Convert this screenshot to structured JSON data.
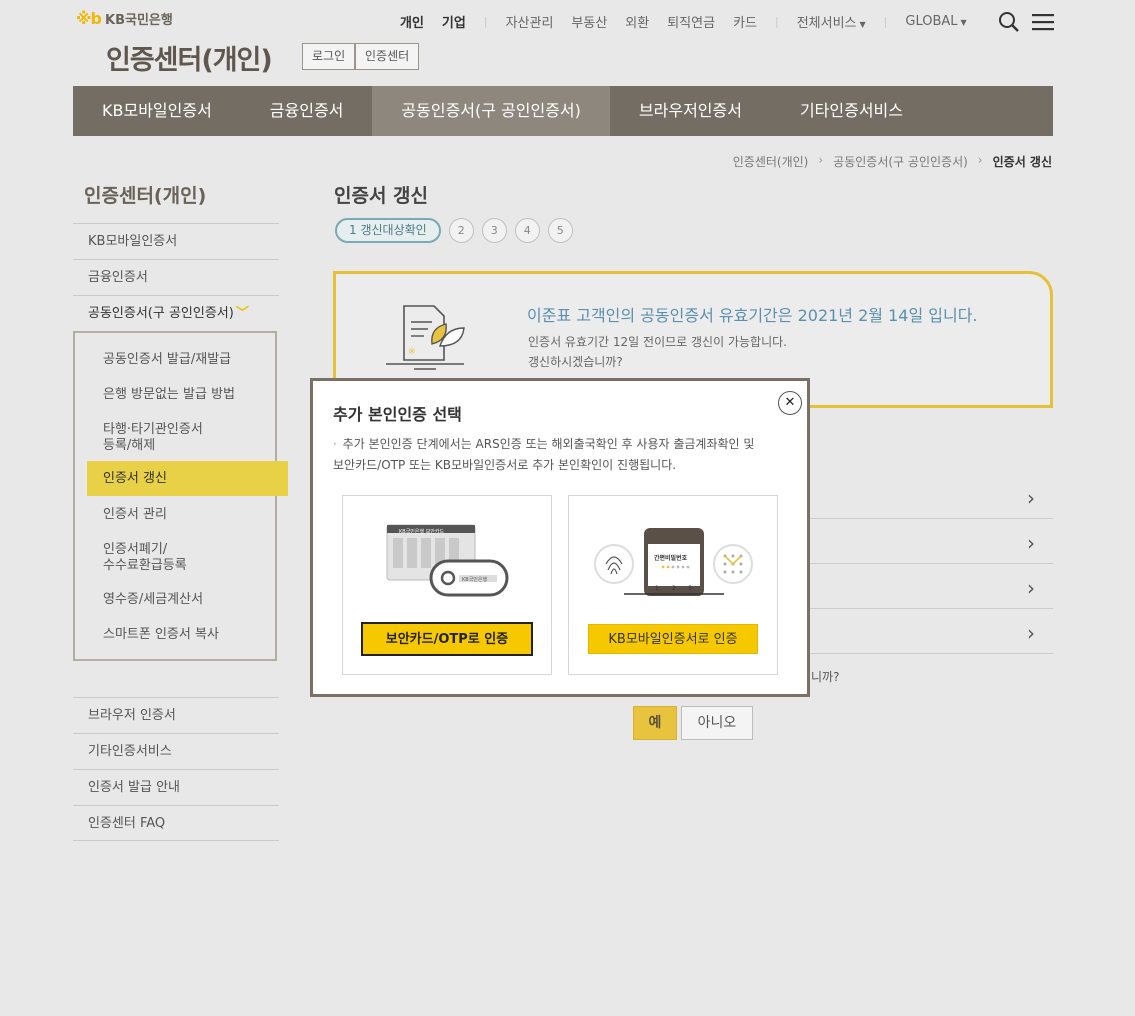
{
  "header": {
    "logo_mark": "※b",
    "logo_text": "KB국민은행",
    "top_nav": {
      "personal": "개인",
      "corporate": "기업",
      "items": [
        "자산관리",
        "부동산",
        "외환",
        "퇴직연금",
        "카드"
      ],
      "all_services": "전체서비스",
      "global": "GLOBAL"
    },
    "page_title": "인증센터(개인)",
    "login_button": "로그인",
    "center_button": "인증센터"
  },
  "gnb": {
    "items": [
      "KB모바일인증서",
      "금융인증서",
      "공동인증서(구 공인인증서)",
      "브라우저인증서",
      "기타인증서비스"
    ]
  },
  "breadcrumb": {
    "home": "인증센터(개인)",
    "parent": "공동인증서(구 공인인증서)",
    "current": "인증서 갱신",
    "sep": "›"
  },
  "lnb": {
    "title": "인증센터(개인)",
    "items_top": [
      "KB모바일인증서",
      "금융인증서"
    ],
    "open_item": "공동인증서(구 공인인증서)",
    "sub_items": [
      "공동인증서 발급/재발급",
      "은행 방문없는 발급 방법",
      "타행·타기관인증서",
      "등록/해제",
      "인증서 갱신",
      "인증서 관리",
      "인증서폐기/",
      "수수료환급등록",
      "영수증/세금계산서",
      "스마트폰 인증서 복사"
    ],
    "items_bottom": [
      "브라우저 인증서",
      "기타인증서비스",
      "인증서 발급 안내",
      "인증센터 FAQ"
    ]
  },
  "content": {
    "title": "인증서 갱신",
    "steps": [
      "1 갱신대상확인",
      "2",
      "3",
      "4",
      "5"
    ],
    "info_main": "이준표 고객인의 공동인증서 유효기간은 2021년 2월 14일 입니다.",
    "info_sub1": "인증서 유효기간 12일 전이므로 갱신이 가능합니다.",
    "info_sub2": "갱신하시겠습니까?",
    "q_tail": "니까?",
    "yes": "예",
    "no": "아니오",
    "arrow": "›"
  },
  "modal": {
    "title": "추가 본인인증 선택",
    "close": "✕",
    "desc_line1": "추가 본인인증 단계에서는 ARS인증 또는 해외출국확인 후 사용자 출금계좌확인 및",
    "desc_line2": "보안카드/OTP 또는 KB모바일인증서로 추가 본인확인이 진행됩니다.",
    "bullet": "·",
    "card_a_button": "보안카드/OTP로 인증",
    "card_b_button": "KB모바일인증서로 인증",
    "phone_screen_text": "간편비밀번호",
    "otp_card_text": "KB국민은행 보안카드",
    "otp_token_text": "KB국민은행",
    "phone_keypad": [
      "1",
      "2",
      "3"
    ]
  }
}
